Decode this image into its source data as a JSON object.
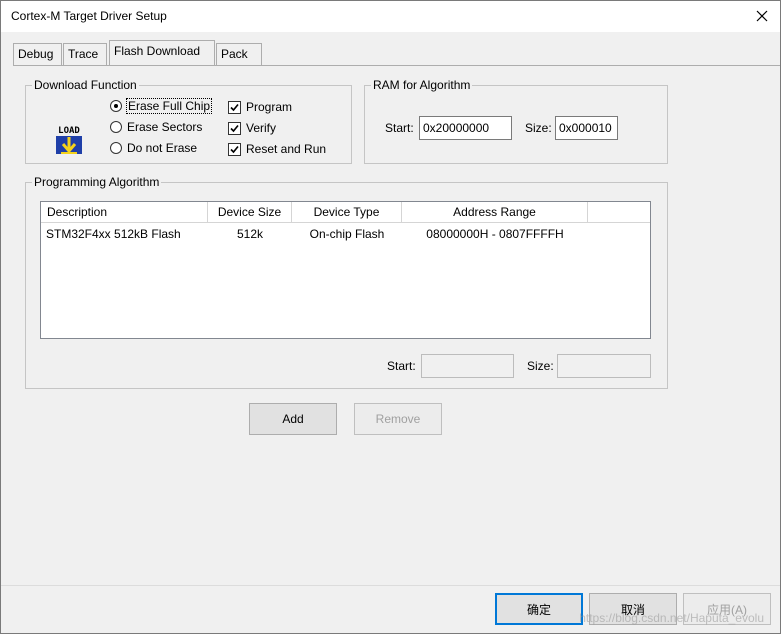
{
  "window": {
    "title": "Cortex-M Target Driver Setup"
  },
  "tabs": [
    {
      "label": "Debug"
    },
    {
      "label": "Trace"
    },
    {
      "label": "Flash Download"
    },
    {
      "label": "Pack"
    }
  ],
  "download_function": {
    "title": "Download Function",
    "icon_text": "LOAD",
    "erase_options": [
      {
        "label": "Erase Full Chip",
        "selected": true
      },
      {
        "label": "Erase Sectors",
        "selected": false
      },
      {
        "label": "Do not Erase",
        "selected": false
      }
    ],
    "checks": [
      {
        "label": "Program",
        "checked": true
      },
      {
        "label": "Verify",
        "checked": true
      },
      {
        "label": "Reset and Run",
        "checked": true
      }
    ]
  },
  "ram_for_algorithm": {
    "title": "RAM for Algorithm",
    "start_label": "Start:",
    "start_value": "0x20000000",
    "size_label": "Size:",
    "size_value": "0x000010"
  },
  "programming_algorithm": {
    "title": "Programming Algorithm",
    "columns": [
      "Description",
      "Device Size",
      "Device Type",
      "Address Range"
    ],
    "rows": [
      [
        "STM32F4xx 512kB Flash",
        "512k",
        "On-chip Flash",
        "08000000H - 0807FFFFH"
      ]
    ],
    "start_label": "Start:",
    "start_value": "",
    "size_label": "Size:",
    "size_value": ""
  },
  "actions": {
    "add_label": "Add",
    "remove_label": "Remove"
  },
  "footer": {
    "ok_label": "确定",
    "cancel_label": "取消",
    "apply_label": "应用(A)"
  },
  "watermark": "https://blog.csdn.net/Haputa_evolu",
  "colors": {
    "accent": "#0078d7",
    "icon_blue": "#1f3fa8",
    "icon_yellow": "#f4d21b"
  }
}
